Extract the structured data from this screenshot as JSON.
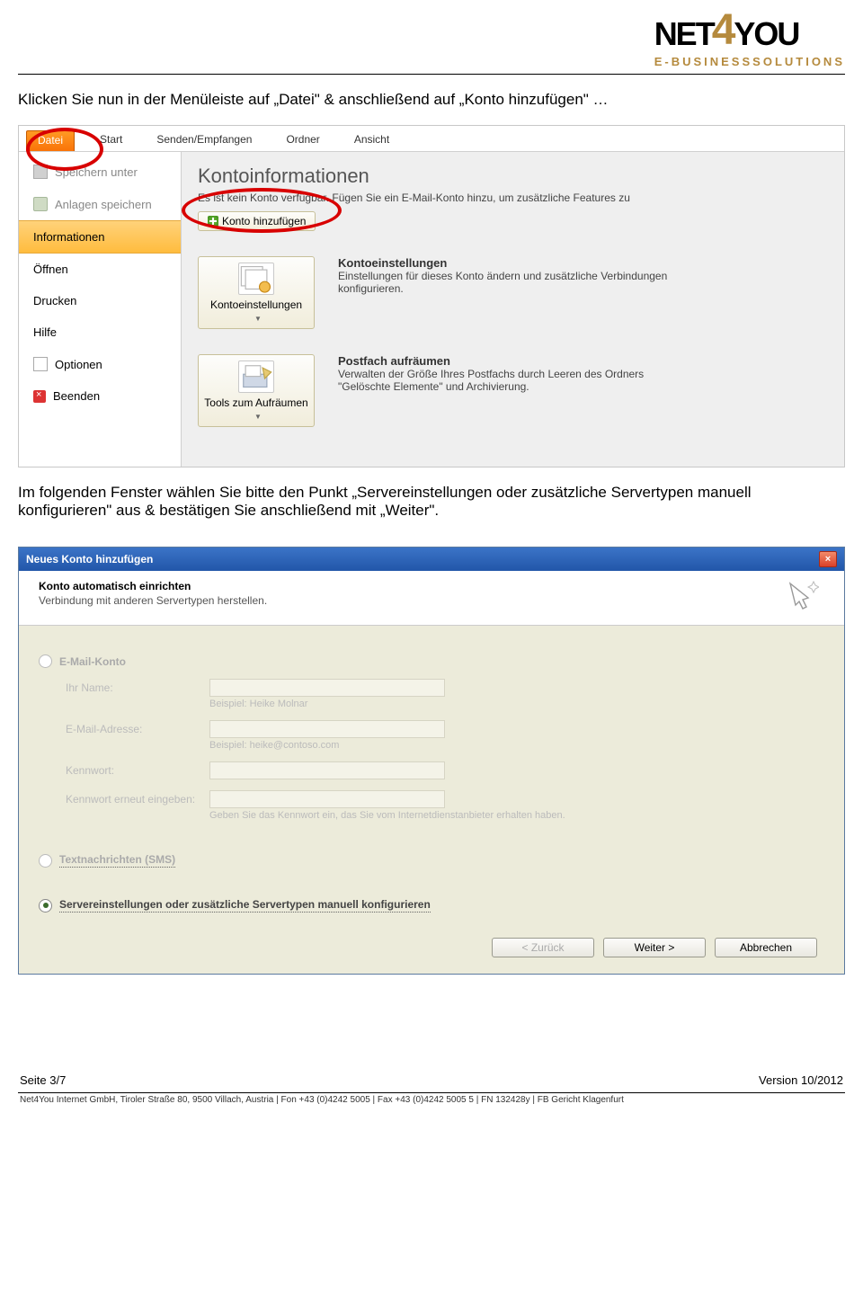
{
  "logo": {
    "net": "NET",
    "four": "4",
    "you": "YOU",
    "ebiz": "E-BUSINESS",
    "sol": "SOLUTIONS"
  },
  "instr1": "Klicken Sie nun in der Menüleiste auf „Datei\" & anschließend auf „Konto hinzufügen\" …",
  "instr2": "Im folgenden Fenster wählen Sie bitte den Punkt „Servereinstellungen oder zusätzliche Servertypen manuell konfigurieren\" aus & bestätigen Sie anschließend mit „Weiter\".",
  "ribbon": {
    "datei": "Datei",
    "start": "Start",
    "senden": "Senden/Empfangen",
    "ordner": "Ordner",
    "ansicht": "Ansicht"
  },
  "side": {
    "speichern": "Speichern unter",
    "anlagen": "Anlagen speichern",
    "info": "Informationen",
    "oeffnen": "Öffnen",
    "drucken": "Drucken",
    "hilfe": "Hilfe",
    "optionen": "Optionen",
    "beenden": "Beenden"
  },
  "main": {
    "title": "Kontoinformationen",
    "sub": "Es ist kein Konto verfügbar. Fügen Sie ein E-Mail-Konto hinzu, um zusätzliche Features zu",
    "addbtn": "Konto hinzufügen",
    "kontoeinst_btn": "Kontoeinstellungen",
    "kontoeinst_title": "Kontoeinstellungen",
    "kontoeinst_desc": "Einstellungen für dieses Konto ändern und zusätzliche Verbindungen konfigurieren.",
    "tools_btn": "Tools zum Aufräumen",
    "postfach_title": "Postfach aufräumen",
    "postfach_desc": "Verwalten der Größe Ihres Postfachs durch Leeren des Ordners \"Gelöschte Elemente\" und Archivierung."
  },
  "dlg": {
    "title": "Neues Konto hinzufügen",
    "sec_title": "Konto automatisch einrichten",
    "sec_sub": "Verbindung mit anderen Servertypen herstellen.",
    "opt_email": "E-Mail-Konto",
    "name_lbl": "Ihr Name:",
    "name_hint": "Beispiel: Heike Molnar",
    "email_lbl": "E-Mail-Adresse:",
    "email_hint": "Beispiel: heike@contoso.com",
    "pw_lbl": "Kennwort:",
    "pw2_lbl": "Kennwort erneut eingeben:",
    "pw_hint": "Geben Sie das Kennwort ein, das Sie vom Internetdienstanbieter erhalten haben.",
    "opt_sms": "Textnachrichten (SMS)",
    "opt_server": "Servereinstellungen oder zusätzliche Servertypen manuell konfigurieren",
    "back": "< Zurück",
    "next": "Weiter >",
    "cancel": "Abbrechen"
  },
  "footer": {
    "page": "Seite 3/7",
    "version": "Version 10/2012",
    "small": "Net4You Internet GmbH, Tiroler Straße 80, 9500 Villach, Austria  |  Fon +43 (0)4242 5005  |  Fax +43 (0)4242 5005 5  |  FN 132428y  |  FB Gericht Klagenfurt"
  }
}
